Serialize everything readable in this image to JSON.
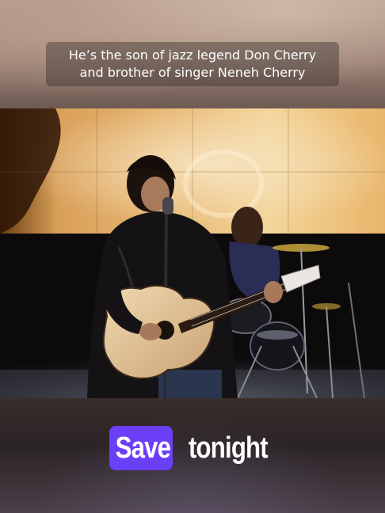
{
  "caption": {
    "line1": "He’s the son of jazz legend Don Cherry",
    "line2": "and brother of singer Neneh Cherry"
  },
  "lyric": {
    "active_word": "Save",
    "next_word": "tonight",
    "highlight_color": "#6b3ff5"
  },
  "scene": {
    "description_icons": [
      "guitarist",
      "acoustic-guitar",
      "microphone-stand",
      "drummer",
      "drum-kit",
      "video-screen-backdrop"
    ]
  }
}
